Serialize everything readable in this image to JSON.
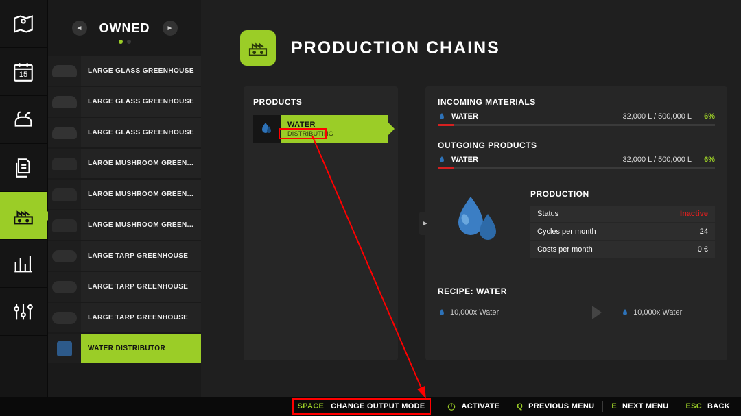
{
  "leftRail": {
    "items": [
      {
        "name": "map-icon"
      },
      {
        "name": "calendar-icon"
      },
      {
        "name": "animals-icon"
      },
      {
        "name": "documents-icon"
      },
      {
        "name": "production-icon"
      },
      {
        "name": "statistics-icon"
      },
      {
        "name": "settings-icon"
      }
    ],
    "activeIndex": 4
  },
  "owned": {
    "title": "OWNED",
    "items": [
      {
        "label": "LARGE GLASS GREENHOUSE",
        "thumb": "glass"
      },
      {
        "label": "LARGE GLASS GREENHOUSE",
        "thumb": "glass"
      },
      {
        "label": "LARGE GLASS GREENHOUSE",
        "thumb": "glass"
      },
      {
        "label": "LARGE MUSHROOM GREEN...",
        "thumb": "mush"
      },
      {
        "label": "LARGE MUSHROOM GREEN...",
        "thumb": "mush"
      },
      {
        "label": "LARGE MUSHROOM GREEN...",
        "thumb": "mush"
      },
      {
        "label": "LARGE TARP GREENHOUSE",
        "thumb": "tarp"
      },
      {
        "label": "LARGE TARP GREENHOUSE",
        "thumb": "tarp"
      },
      {
        "label": "LARGE TARP GREENHOUSE",
        "thumb": "tarp"
      },
      {
        "label": "WATER DISTRIBUTOR",
        "thumb": "water"
      }
    ],
    "selectedIndex": 9
  },
  "page": {
    "title": "PRODUCTION CHAINS"
  },
  "products": {
    "sectionTitle": "PRODUCTS",
    "items": [
      {
        "name": "WATER",
        "mode": "DISTRIBUTING"
      }
    ]
  },
  "incoming": {
    "title": "INCOMING MATERIALS",
    "rows": [
      {
        "name": "WATER",
        "amount": "32,000 L / 500,000 L",
        "pct": "6%",
        "fill": 6
      }
    ]
  },
  "outgoing": {
    "title": "OUTGOING PRODUCTS",
    "rows": [
      {
        "name": "WATER",
        "amount": "32,000 L / 500,000 L",
        "pct": "6%",
        "fill": 6
      }
    ]
  },
  "production": {
    "title": "PRODUCTION",
    "rows": [
      {
        "label": "Status",
        "value": "Inactive",
        "inactive": true
      },
      {
        "label": "Cycles per month",
        "value": "24"
      },
      {
        "label": "Costs per month",
        "value": "0 €"
      }
    ]
  },
  "recipe": {
    "title": "RECIPE: WATER",
    "input": "10,000x Water",
    "output": "10,000x Water"
  },
  "footer": {
    "space": {
      "key": "SPACE",
      "label": "CHANGE OUTPUT MODE"
    },
    "activate": {
      "label": "ACTIVATE"
    },
    "prev": {
      "key": "Q",
      "label": "PREVIOUS MENU"
    },
    "next": {
      "key": "E",
      "label": "NEXT MENU"
    },
    "back": {
      "key": "ESC",
      "label": "BACK"
    }
  }
}
